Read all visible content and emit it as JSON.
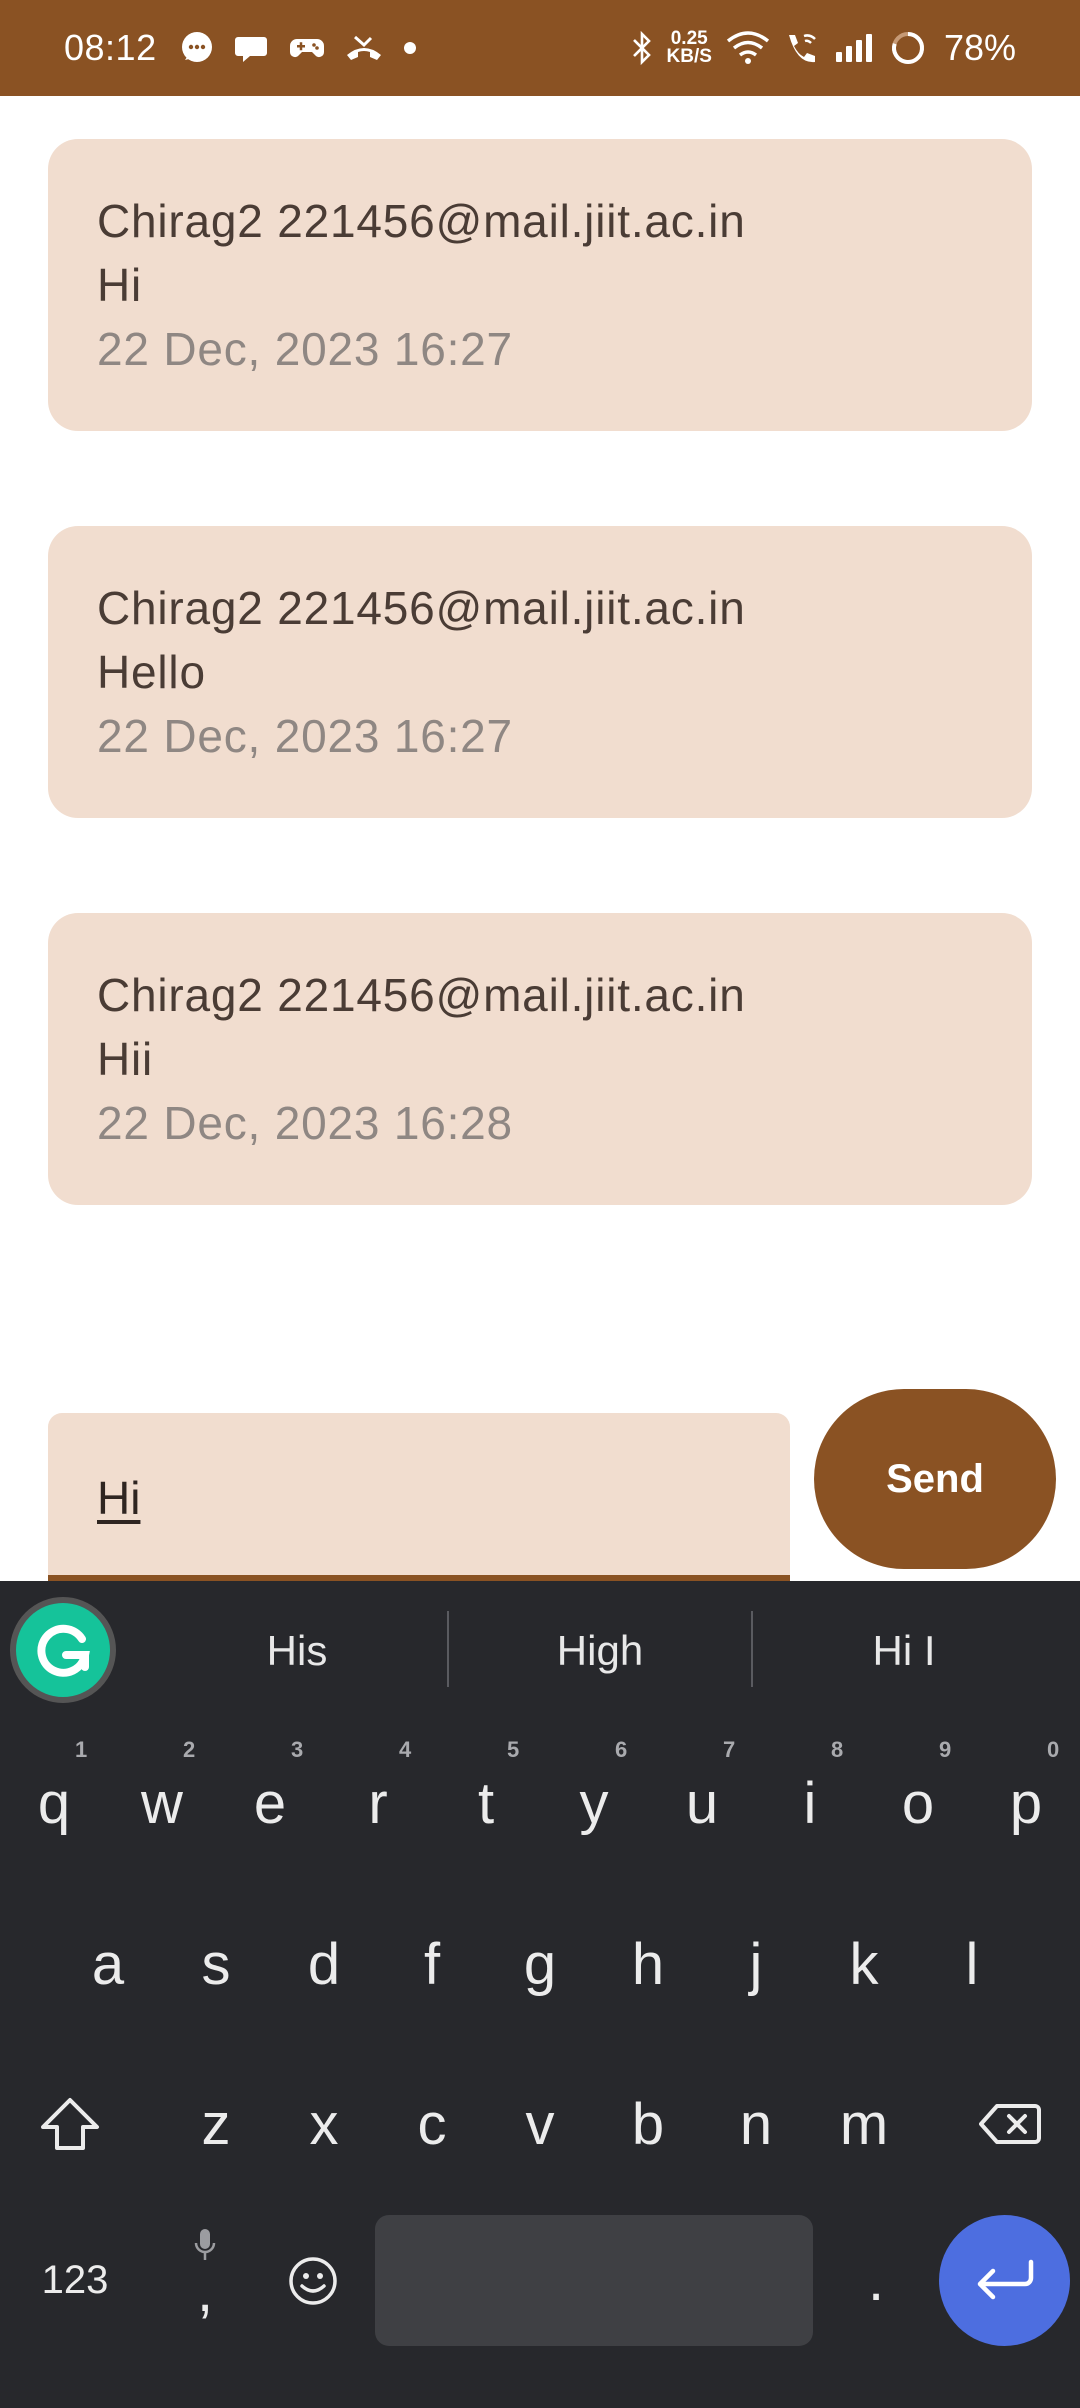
{
  "status_bar": {
    "time": "08:12",
    "network_speed_value": "0.25",
    "network_speed_unit": "KB/S",
    "battery": "78%",
    "icons": [
      "chat-bubble-icon",
      "speech-bubble-icon",
      "game-controller-icon",
      "missed-call-icon",
      "dot-icon",
      "bluetooth-icon",
      "wifi-icon",
      "wifi-calling-icon",
      "signal-icon",
      "battery-ring-icon"
    ]
  },
  "messages": [
    {
      "sender": "Chirag2 221456@mail.jiit.ac.in",
      "text": "Hi",
      "time": "22 Dec, 2023 16:27"
    },
    {
      "sender": "Chirag2 221456@mail.jiit.ac.in",
      "text": "Hello",
      "time": "22 Dec, 2023 16:27"
    },
    {
      "sender": "Chirag2 221456@mail.jiit.ac.in",
      "text": "Hii",
      "time": "22 Dec, 2023 16:28"
    }
  ],
  "composer": {
    "input_value": "Hi",
    "send_label": "Send"
  },
  "keyboard": {
    "suggestions": [
      "His",
      "High",
      "Hi I"
    ],
    "row1": [
      "q",
      "w",
      "e",
      "r",
      "t",
      "y",
      "u",
      "i",
      "o",
      "p"
    ],
    "row1_hints": [
      "1",
      "2",
      "3",
      "4",
      "5",
      "6",
      "7",
      "8",
      "9",
      "0"
    ],
    "row2": [
      "a",
      "s",
      "d",
      "f",
      "g",
      "h",
      "j",
      "k",
      "l"
    ],
    "row3": [
      "z",
      "x",
      "c",
      "v",
      "b",
      "n",
      "m"
    ],
    "symbols_label": "123",
    "comma_label": ",",
    "period_label": ".",
    "accent_color": "#4d6ee0",
    "brand_color": "#8a5223"
  }
}
